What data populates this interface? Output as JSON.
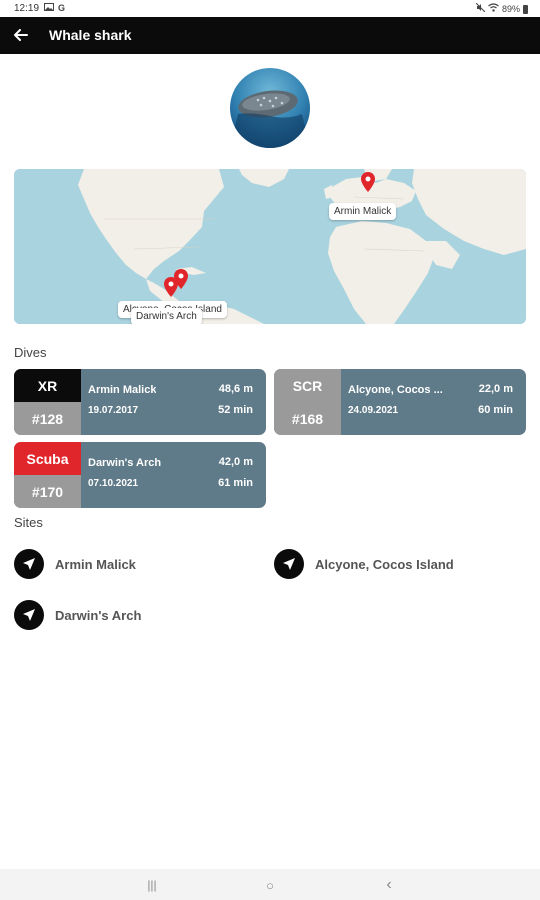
{
  "status_bar": {
    "time": "12:19",
    "icons_left": [
      "image-icon",
      "google-g-icon"
    ],
    "icons_right": [
      "mute-icon",
      "wifi-icon"
    ],
    "battery": "89%"
  },
  "app_bar": {
    "title": "Whale shark",
    "back_icon": "arrow-left-icon"
  },
  "map": {
    "labels": {
      "armin": "Armin Malick",
      "alcyone": "Alcyone, Cocos Island",
      "darwin": "Darwin's Arch"
    },
    "colors": {
      "water": "#a9d3df",
      "land": "#f2efe8",
      "pin": "#e0262b"
    }
  },
  "sections": {
    "dives": "Dives",
    "sites": "Sites"
  },
  "dives": [
    {
      "type": "XR",
      "number": "#128",
      "site": "Armin Malick",
      "date": "19.07.2017",
      "depth": "48,6 m",
      "duration": "52 min",
      "type_color": "#0b0b0b"
    },
    {
      "type": "SCR",
      "number": "#168",
      "site": "Alcyone, Cocos ...",
      "date": "24.09.2021",
      "depth": "22,0 m",
      "duration": "60 min",
      "type_color": "#9a9a9a"
    },
    {
      "type": "Scuba",
      "number": "#170",
      "site": "Darwin's Arch",
      "date": "07.10.2021",
      "depth": "42,0 m",
      "duration": "61 min",
      "type_color": "#e0262b"
    }
  ],
  "sites": [
    {
      "name": "Armin Malick",
      "icon": "navigation-arrow-icon"
    },
    {
      "name": "Alcyone, Cocos Island",
      "icon": "navigation-arrow-icon"
    },
    {
      "name": "Darwin's Arch",
      "icon": "navigation-arrow-icon"
    }
  ],
  "nav_bar": {
    "recents": "|||",
    "home": "○",
    "back": "‹"
  }
}
